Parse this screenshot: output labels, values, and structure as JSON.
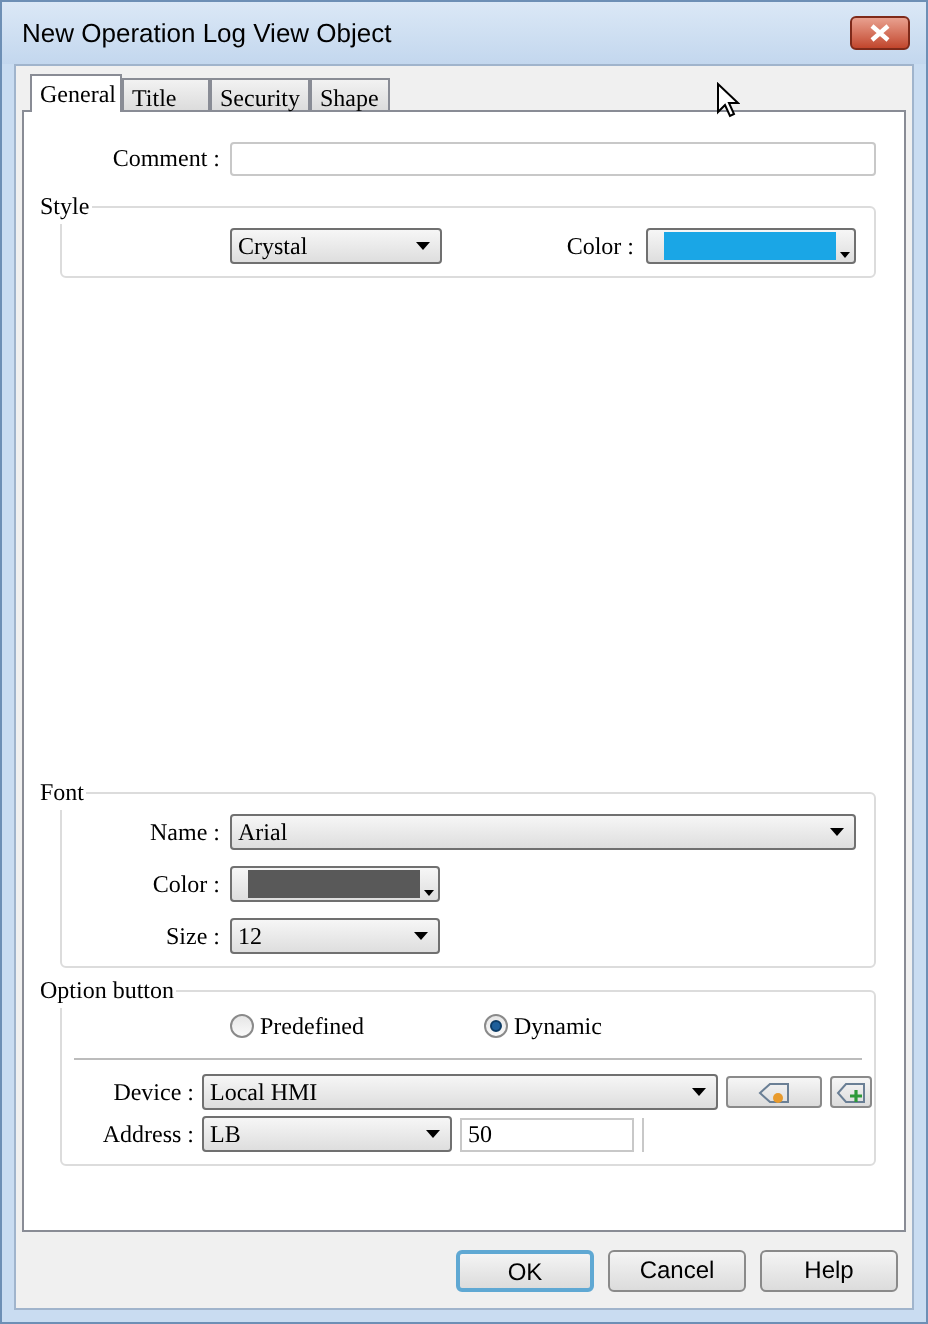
{
  "window": {
    "title": "New Operation Log View Object"
  },
  "tabs": [
    {
      "label": "General",
      "selected": true
    },
    {
      "label": "Title",
      "selected": false
    },
    {
      "label": "Security",
      "selected": false
    },
    {
      "label": "Shape",
      "selected": false
    }
  ],
  "comment": {
    "label": "Comment :"
  },
  "style": {
    "title": "Style",
    "value": "Crystal",
    "color_label": "Color :",
    "color": "#1aa6e6"
  },
  "font": {
    "title": "Font",
    "name_label": "Name :",
    "name": "Arial",
    "color_label": "Color :",
    "color": "#595959",
    "size_label": "Size :",
    "size": "12"
  },
  "option_button": {
    "title": "Option button",
    "options": [
      {
        "label": "Predefined",
        "selected": false
      },
      {
        "label": "Dynamic",
        "selected": true
      }
    ],
    "device_label": "Device :",
    "device": "Local HMI",
    "address_label": "Address :",
    "address_type": "LB",
    "address": "50"
  },
  "buttons": [
    {
      "label": "OK",
      "default": true
    },
    {
      "label": "Cancel",
      "default": false
    },
    {
      "label": "Help",
      "default": false
    }
  ]
}
